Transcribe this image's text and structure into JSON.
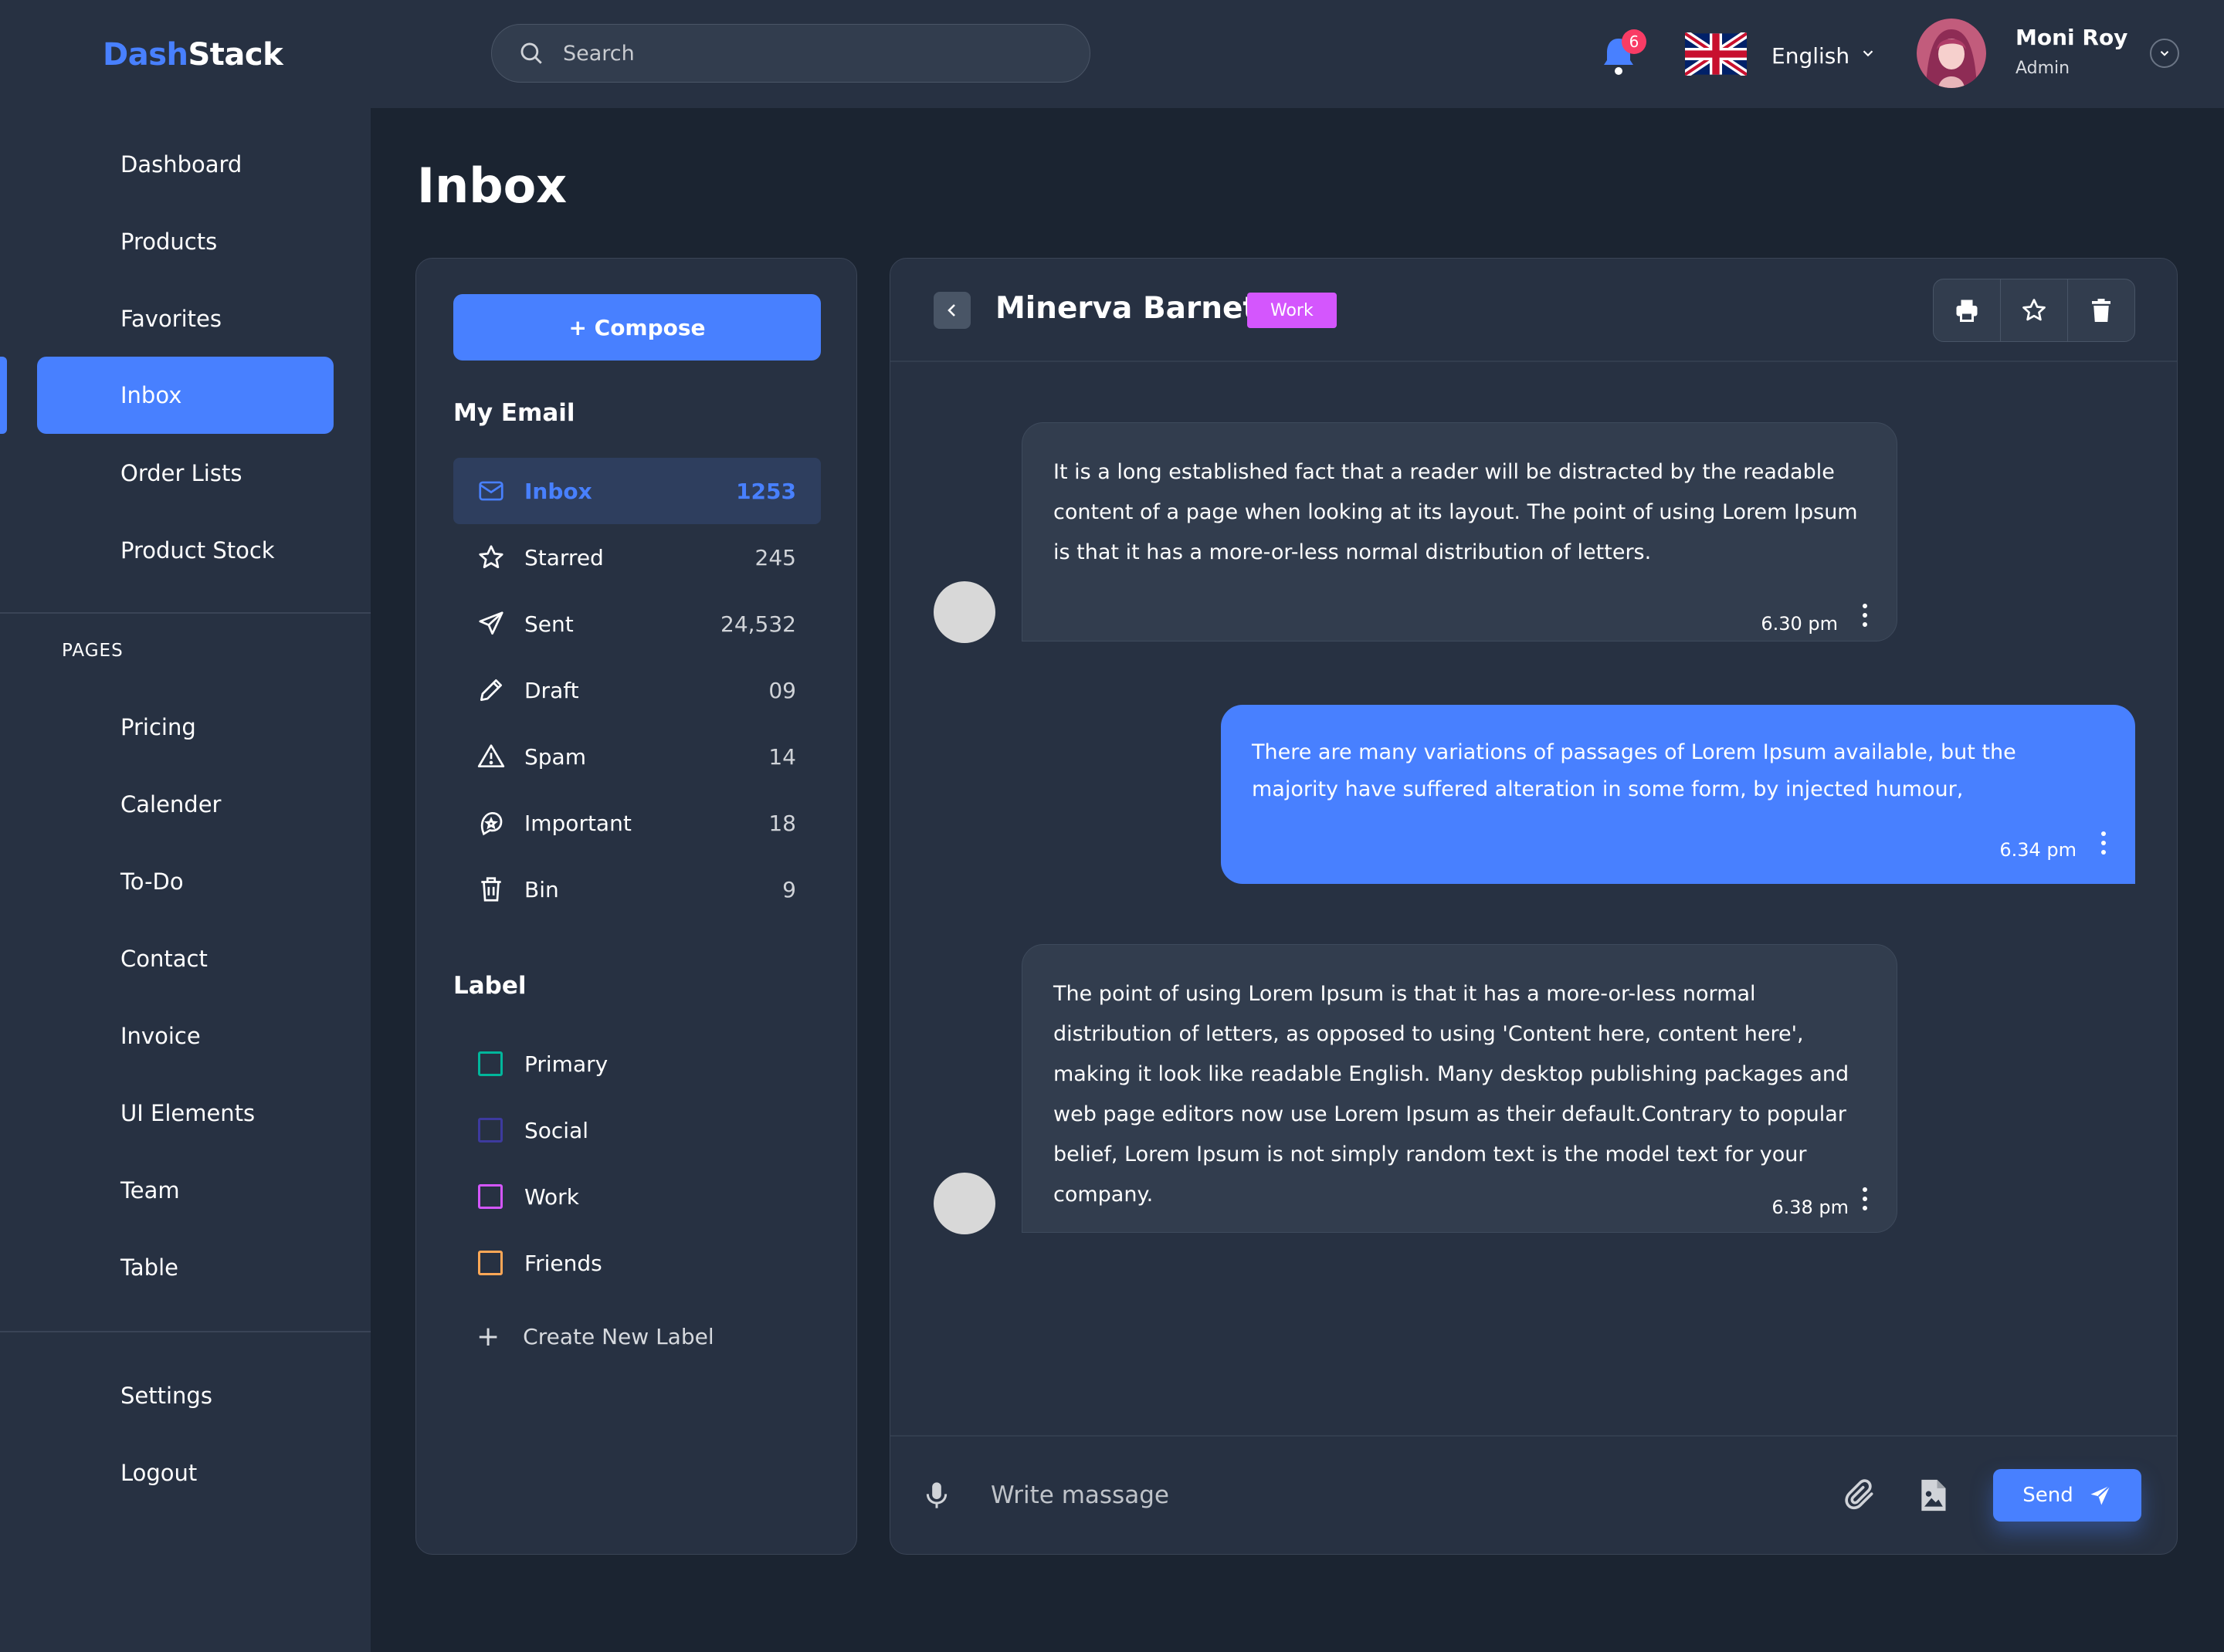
{
  "brand": {
    "part1": "Dash",
    "part2": "Stack"
  },
  "search": {
    "placeholder": "Search"
  },
  "notifications": {
    "count": "6"
  },
  "language": {
    "selected": "English"
  },
  "user": {
    "name": "Moni Roy",
    "role": "Admin"
  },
  "sidebar": {
    "items": [
      {
        "label": "Dashboard"
      },
      {
        "label": "Products"
      },
      {
        "label": "Favorites"
      },
      {
        "label": "Inbox",
        "active": true
      },
      {
        "label": "Order Lists"
      },
      {
        "label": "Product Stock"
      }
    ],
    "pages_heading": "PAGES",
    "pages": [
      {
        "label": "Pricing"
      },
      {
        "label": "Calender"
      },
      {
        "label": "To-Do"
      },
      {
        "label": "Contact"
      },
      {
        "label": "Invoice"
      },
      {
        "label": "UI Elements"
      },
      {
        "label": "Team"
      },
      {
        "label": "Table"
      }
    ],
    "bottom": [
      {
        "label": "Settings"
      },
      {
        "label": "Logout"
      }
    ]
  },
  "page": {
    "title": "Inbox"
  },
  "mailbox": {
    "compose_label": "+ Compose",
    "my_email_heading": "My Email",
    "folders": [
      {
        "label": "Inbox",
        "count": "1253",
        "icon": "mail-icon",
        "active": true
      },
      {
        "label": "Starred",
        "count": "245",
        "icon": "star-icon"
      },
      {
        "label": "Sent",
        "count": "24,532",
        "icon": "send-icon"
      },
      {
        "label": "Draft",
        "count": "09",
        "icon": "pencil-icon"
      },
      {
        "label": "Spam",
        "count": "14",
        "icon": "warning-icon"
      },
      {
        "label": "Important",
        "count": "18",
        "icon": "important-icon"
      },
      {
        "label": "Bin",
        "count": "9",
        "icon": "trash-icon"
      }
    ],
    "label_heading": "Label",
    "labels": [
      {
        "label": "Primary",
        "color": "#00b69b"
      },
      {
        "label": "Social",
        "color": "#5a4fd8"
      },
      {
        "label": "Work",
        "color": "#d456fd"
      },
      {
        "label": "Friends",
        "color": "#ffa756"
      }
    ],
    "create_label": "Create New Label"
  },
  "thread": {
    "contact": "Minerva Barnett",
    "tag": "Work",
    "tag_color": "#d456fd",
    "messages": [
      {
        "direction": "in",
        "text": "It is a long established fact that a reader will be distracted by the readable content of a page when looking at its layout. The point of using Lorem Ipsum is that it has a more-or-less normal distribution of letters.",
        "time": "6.30 pm"
      },
      {
        "direction": "out",
        "text": "There are many variations of passages of Lorem Ipsum available, but the majority have suffered alteration in some form, by injected humour,",
        "time": "6.34 pm"
      },
      {
        "direction": "in",
        "text": "The point of using Lorem Ipsum is that it has a more-or-less normal distribution of letters, as opposed to using 'Content here, content here', making it look like readable English. Many desktop publishing packages and web page editors now use Lorem Ipsum as their default.Contrary to popular belief, Lorem Ipsum is not simply random text is the model text for your company.",
        "time": "6.38 pm"
      }
    ]
  },
  "composer": {
    "placeholder": "Write massage",
    "send_label": "Send"
  },
  "colors": {
    "accent": "#4880ff",
    "background": "#1b2431",
    "surface": "#273142"
  }
}
